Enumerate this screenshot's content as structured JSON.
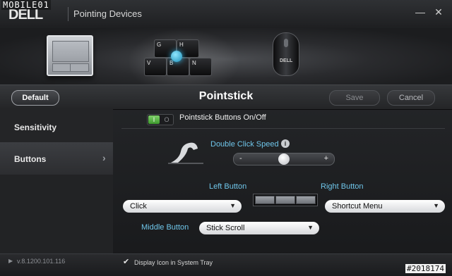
{
  "watermark": "MOBILE01",
  "window": {
    "logo": "DELL",
    "title": "Pointing Devices",
    "minimize": "—",
    "close": "✕"
  },
  "devices": [
    {
      "name": "touchpad",
      "selected": false
    },
    {
      "name": "pointstick",
      "selected": true,
      "keys": [
        "G",
        "H",
        "V",
        "B",
        "N"
      ]
    },
    {
      "name": "mouse",
      "selected": false,
      "brand": "DELL"
    }
  ],
  "toolbar": {
    "default_label": "Default",
    "title": "Pointstick",
    "save_label": "Save",
    "cancel_label": "Cancel"
  },
  "sidebar": {
    "items": [
      {
        "label": "Sensitivity",
        "selected": false
      },
      {
        "label": "Buttons",
        "selected": true
      }
    ],
    "arrow": "›"
  },
  "main": {
    "toggle": {
      "on": "I",
      "off": "O",
      "state": true
    },
    "toggle_label": "Pointstick Buttons On/Off",
    "double_click": {
      "label": "Double Click Speed",
      "info": "i",
      "minus": "-",
      "plus": "+",
      "value_fraction": 0.5
    },
    "left_button": {
      "label": "Left Button",
      "value": "Click"
    },
    "right_button": {
      "label": "Right Button",
      "value": "Shortcut Menu"
    },
    "middle_button": {
      "label": "Middle Button",
      "value": "Stick Scroll"
    },
    "dropdown_arrow": "▼"
  },
  "footer": {
    "caret": "▶",
    "version": "v.8.1200.101.116",
    "tray_check": "✔",
    "tray_label": "Display Icon in System Tray",
    "tray_checked": true,
    "id_tag": "#2018174"
  },
  "colors": {
    "accent": "#6fc6ea",
    "toggle_on": "#5cb848",
    "nub": "#34b6e6"
  }
}
